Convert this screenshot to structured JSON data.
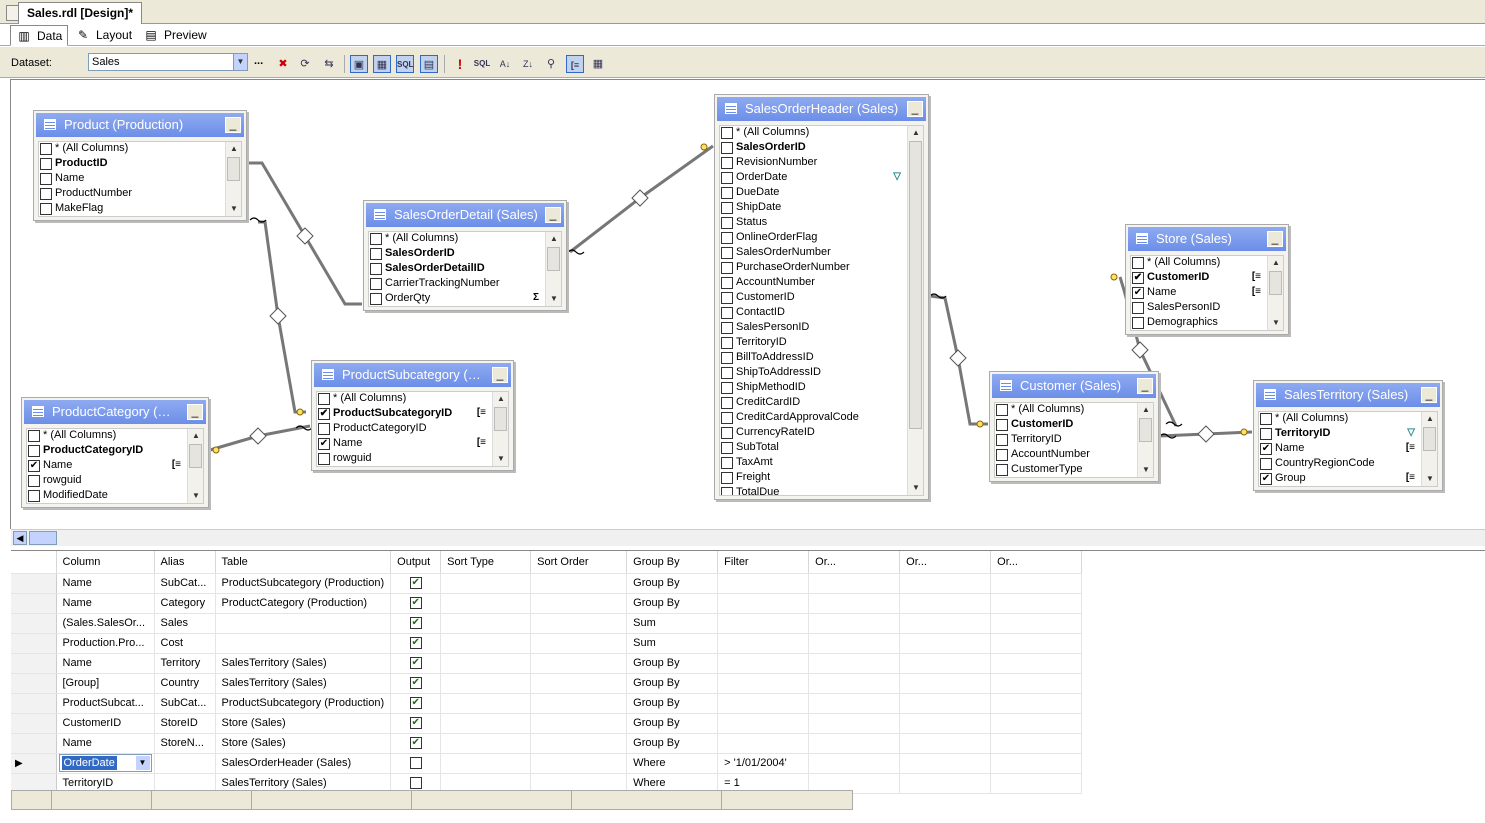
{
  "document_tab": {
    "title": "Sales.rdl [Design]*"
  },
  "view_tabs": [
    {
      "label": "Data",
      "icon": "data-icon"
    },
    {
      "label": "Layout",
      "icon": "layout-icon"
    },
    {
      "label": "Preview",
      "icon": "preview-icon"
    }
  ],
  "toolbar": {
    "dataset_label": "Dataset:",
    "dataset_value": "Sales",
    "ellipsis": "..."
  },
  "tables": {
    "product": {
      "title": "Product (Production)",
      "rows": [
        {
          "label": "* (All Columns)",
          "checked": false,
          "key": false
        },
        {
          "label": "ProductID",
          "checked": false,
          "key": true
        },
        {
          "label": "Name",
          "checked": false,
          "key": false
        },
        {
          "label": "ProductNumber",
          "checked": false,
          "key": false
        },
        {
          "label": "MakeFlag",
          "checked": false,
          "key": false
        }
      ]
    },
    "sod": {
      "title": "SalesOrderDetail (Sales)",
      "rows": [
        {
          "label": "* (All Columns)",
          "checked": false,
          "key": false
        },
        {
          "label": "SalesOrderID",
          "checked": false,
          "key": true
        },
        {
          "label": "SalesOrderDetailID",
          "checked": false,
          "key": true
        },
        {
          "label": "CarrierTrackingNumber",
          "checked": false,
          "key": false
        },
        {
          "label": "OrderQty",
          "checked": false,
          "key": false,
          "icon": "Σ"
        }
      ]
    },
    "soh": {
      "title": "SalesOrderHeader (Sales)",
      "rows": [
        {
          "label": "* (All Columns)",
          "checked": false,
          "key": false
        },
        {
          "label": "SalesOrderID",
          "checked": false,
          "key": true
        },
        {
          "label": "RevisionNumber",
          "checked": false,
          "key": false
        },
        {
          "label": "OrderDate",
          "checked": false,
          "key": false,
          "icon": "filter"
        },
        {
          "label": "DueDate",
          "checked": false,
          "key": false
        },
        {
          "label": "ShipDate",
          "checked": false,
          "key": false
        },
        {
          "label": "Status",
          "checked": false,
          "key": false
        },
        {
          "label": "OnlineOrderFlag",
          "checked": false,
          "key": false
        },
        {
          "label": "SalesOrderNumber",
          "checked": false,
          "key": false
        },
        {
          "label": "PurchaseOrderNumber",
          "checked": false,
          "key": false
        },
        {
          "label": "AccountNumber",
          "checked": false,
          "key": false
        },
        {
          "label": "CustomerID",
          "checked": false,
          "key": false
        },
        {
          "label": "ContactID",
          "checked": false,
          "key": false
        },
        {
          "label": "SalesPersonID",
          "checked": false,
          "key": false
        },
        {
          "label": "TerritoryID",
          "checked": false,
          "key": false
        },
        {
          "label": "BillToAddressID",
          "checked": false,
          "key": false
        },
        {
          "label": "ShipToAddressID",
          "checked": false,
          "key": false
        },
        {
          "label": "ShipMethodID",
          "checked": false,
          "key": false
        },
        {
          "label": "CreditCardID",
          "checked": false,
          "key": false
        },
        {
          "label": "CreditCardApprovalCode",
          "checked": false,
          "key": false
        },
        {
          "label": "CurrencyRateID",
          "checked": false,
          "key": false
        },
        {
          "label": "SubTotal",
          "checked": false,
          "key": false
        },
        {
          "label": "TaxAmt",
          "checked": false,
          "key": false
        },
        {
          "label": "Freight",
          "checked": false,
          "key": false
        },
        {
          "label": "TotalDue",
          "checked": false,
          "key": false
        }
      ]
    },
    "store": {
      "title": "Store (Sales)",
      "rows": [
        {
          "label": "* (All Columns)",
          "checked": false,
          "key": false
        },
        {
          "label": "CustomerID",
          "checked": true,
          "key": true,
          "icon": "group"
        },
        {
          "label": "Name",
          "checked": true,
          "key": false,
          "icon": "group"
        },
        {
          "label": "SalesPersonID",
          "checked": false,
          "key": false
        },
        {
          "label": "Demographics",
          "checked": false,
          "key": false
        }
      ]
    },
    "pcat": {
      "title": "ProductCategory (…",
      "rows": [
        {
          "label": "* (All Columns)",
          "checked": false,
          "key": false
        },
        {
          "label": "ProductCategoryID",
          "checked": false,
          "key": true
        },
        {
          "label": "Name",
          "checked": true,
          "key": false,
          "icon": "group"
        },
        {
          "label": "rowguid",
          "checked": false,
          "key": false
        },
        {
          "label": "ModifiedDate",
          "checked": false,
          "key": false
        }
      ]
    },
    "psub": {
      "title": "ProductSubcategory (…",
      "rows": [
        {
          "label": "* (All Columns)",
          "checked": false,
          "key": false
        },
        {
          "label": "ProductSubcategoryID",
          "checked": true,
          "key": true,
          "icon": "group"
        },
        {
          "label": "ProductCategoryID",
          "checked": false,
          "key": false
        },
        {
          "label": "Name",
          "checked": true,
          "key": false,
          "icon": "group"
        },
        {
          "label": "rowguid",
          "checked": false,
          "key": false
        }
      ]
    },
    "customer": {
      "title": "Customer (Sales)",
      "rows": [
        {
          "label": "* (All Columns)",
          "checked": false,
          "key": false
        },
        {
          "label": "CustomerID",
          "checked": false,
          "key": true
        },
        {
          "label": "TerritoryID",
          "checked": false,
          "key": false
        },
        {
          "label": "AccountNumber",
          "checked": false,
          "key": false
        },
        {
          "label": "CustomerType",
          "checked": false,
          "key": false
        }
      ]
    },
    "territory": {
      "title": "SalesTerritory (Sales)",
      "rows": [
        {
          "label": "* (All Columns)",
          "checked": false,
          "key": false
        },
        {
          "label": "TerritoryID",
          "checked": false,
          "key": true,
          "icon": "filter"
        },
        {
          "label": "Name",
          "checked": true,
          "key": false,
          "icon": "group"
        },
        {
          "label": "CountryRegionCode",
          "checked": false,
          "key": false
        },
        {
          "label": "Group",
          "checked": true,
          "key": false,
          "icon": "group"
        }
      ]
    }
  },
  "grid": {
    "headers": [
      "Column",
      "Alias",
      "Table",
      "Output",
      "Sort Type",
      "Sort Order",
      "Group By",
      "Filter",
      "Or...",
      "Or...",
      "Or..."
    ],
    "rows": [
      {
        "column": "Name",
        "alias": "SubCat...",
        "table": "ProductSubcategory (Production)",
        "output": true,
        "group_by": "Group By",
        "filter": ""
      },
      {
        "column": "Name",
        "alias": "Category",
        "table": "ProductCategory (Production)",
        "output": true,
        "group_by": "Group By",
        "filter": ""
      },
      {
        "column": "(Sales.SalesOr...",
        "alias": "Sales",
        "table": "",
        "output": true,
        "group_by": "Sum",
        "filter": ""
      },
      {
        "column": "Production.Pro...",
        "alias": "Cost",
        "table": "",
        "output": true,
        "group_by": "Sum",
        "filter": ""
      },
      {
        "column": "Name",
        "alias": "Territory",
        "table": "SalesTerritory (Sales)",
        "output": true,
        "group_by": "Group By",
        "filter": ""
      },
      {
        "column": "[Group]",
        "alias": "Country",
        "table": "SalesTerritory (Sales)",
        "output": true,
        "group_by": "Group By",
        "filter": ""
      },
      {
        "column": "ProductSubcat...",
        "alias": "SubCat...",
        "table": "ProductSubcategory (Production)",
        "output": true,
        "group_by": "Group By",
        "filter": ""
      },
      {
        "column": "CustomerID",
        "alias": "StoreID",
        "table": "Store (Sales)",
        "output": true,
        "group_by": "Group By",
        "filter": ""
      },
      {
        "column": "Name",
        "alias": "StoreN...",
        "table": "Store (Sales)",
        "output": true,
        "group_by": "Group By",
        "filter": ""
      },
      {
        "column": "OrderDate",
        "alias": "",
        "table": "SalesOrderHeader (Sales)",
        "output": false,
        "group_by": "Where",
        "filter": "> '1/01/2004'",
        "current": true
      },
      {
        "column": "TerritoryID",
        "alias": "",
        "table": "SalesTerritory (Sales)",
        "output": false,
        "group_by": "Where",
        "filter": "= 1"
      }
    ]
  }
}
